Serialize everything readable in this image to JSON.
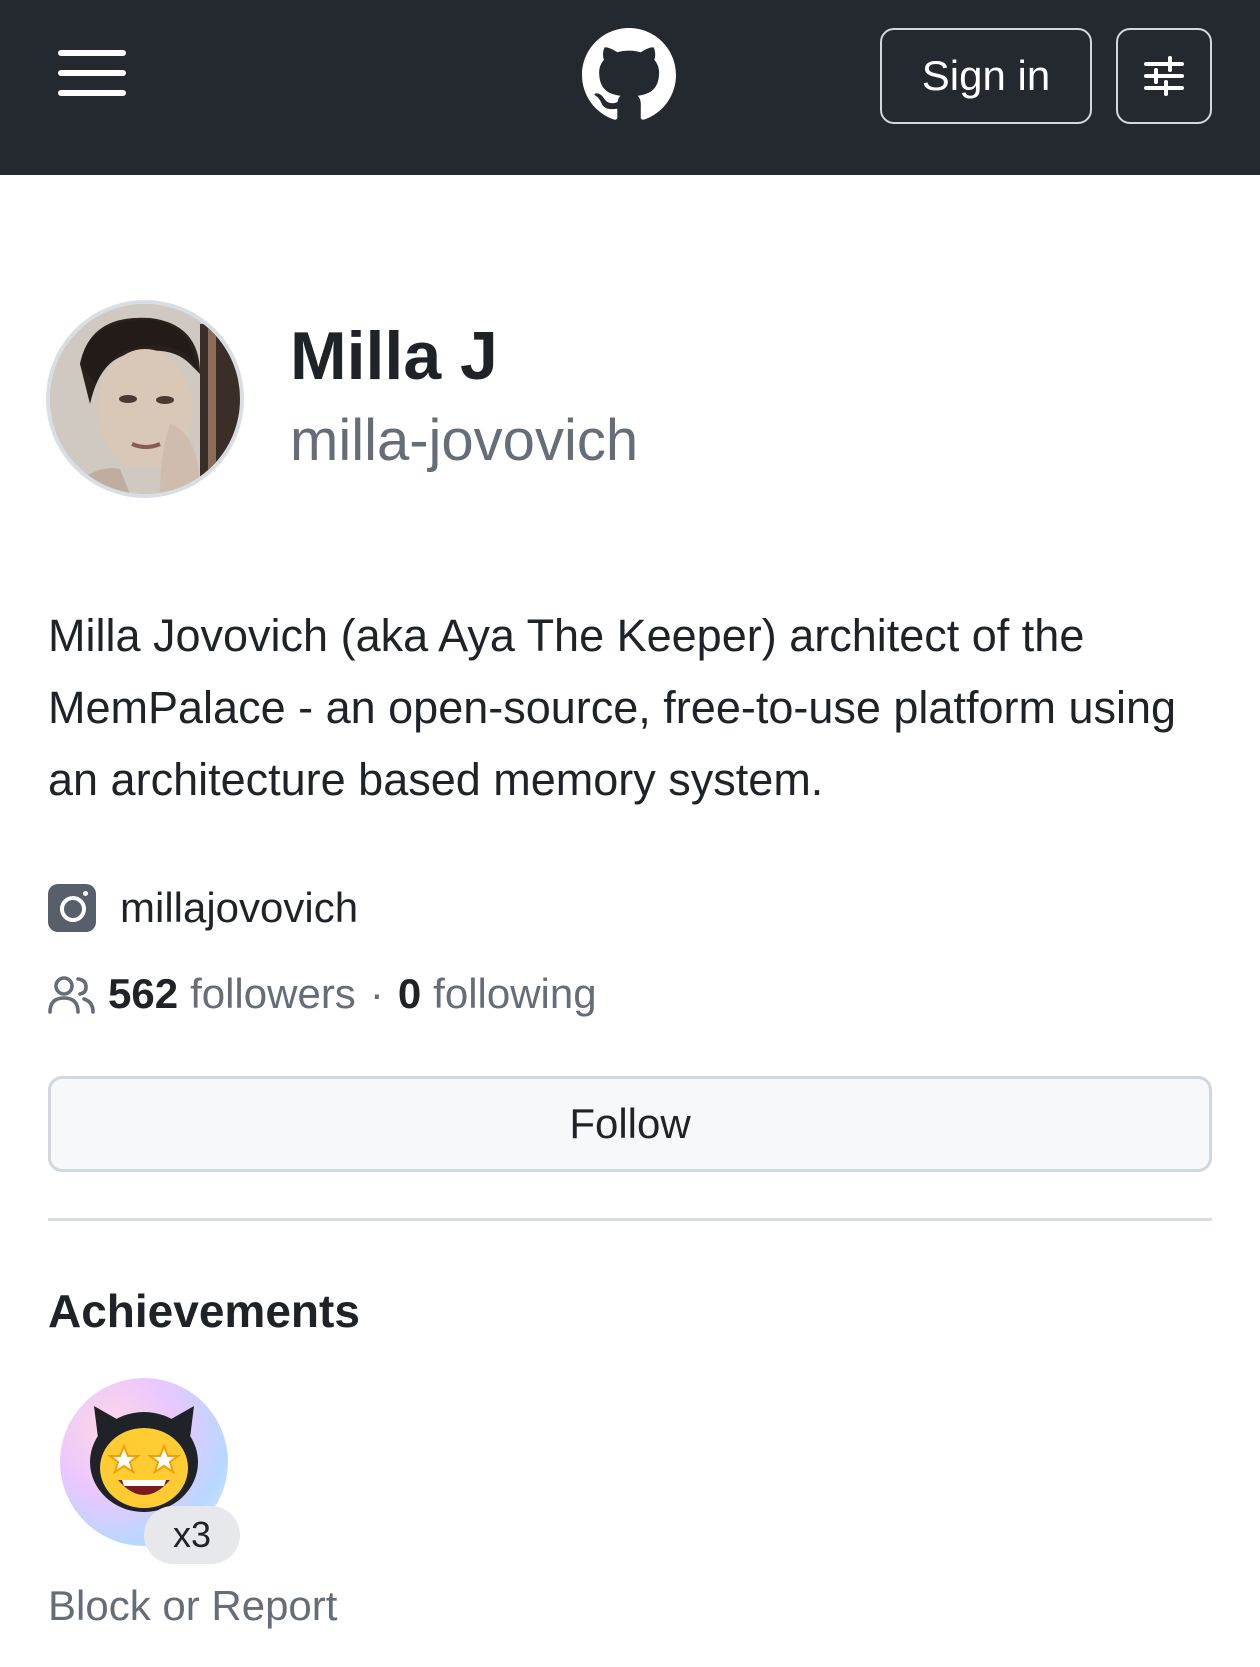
{
  "header": {
    "menu_icon": "hamburger-icon",
    "logo_icon": "github-logo-icon",
    "sign_in_label": "Sign in",
    "settings_icon": "sliders-icon"
  },
  "profile": {
    "avatar_icon": "avatar",
    "display_name": "Milla J",
    "login": "milla-jovovich",
    "bio": "Milla Jovovich (aka Aya The Keeper) architect of the MemPalace - an open-source, free-to-use platform using an architecture based memory system.",
    "social": {
      "icon": "instagram-icon",
      "handle": "millajovovich"
    },
    "followers_count": "562",
    "followers_label": "followers",
    "separator": "·",
    "following_count": "0",
    "following_label": "following",
    "follow_button": "Follow"
  },
  "achievements": {
    "title": "Achievements",
    "badges": [
      {
        "icon": "starstruck-achievement-icon",
        "count": "x3"
      }
    ]
  },
  "footer": {
    "block_report": "Block or Report"
  },
  "colors": {
    "header_bg": "#24292f",
    "text_primary": "#1f2328",
    "text_muted": "#656d76",
    "border": "#d0d7de",
    "button_bg": "#f6f8fa"
  }
}
